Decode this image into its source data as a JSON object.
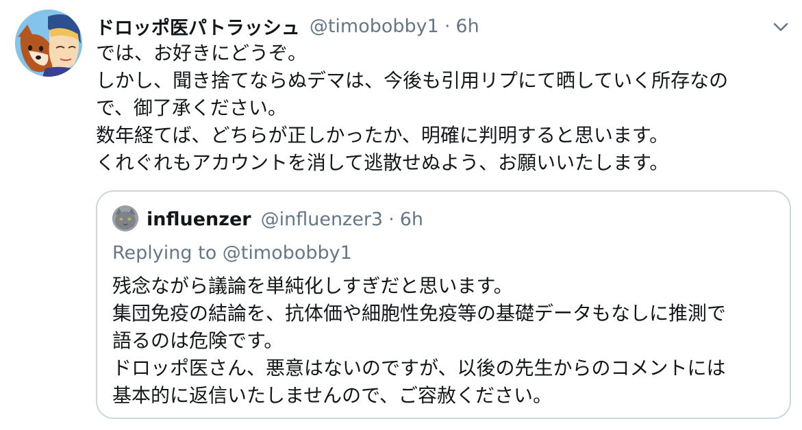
{
  "tweet": {
    "author": {
      "display_name": "ドロッポ医パトラッシュ",
      "handle": "@timobobby1",
      "separator": "·",
      "time": "6h"
    },
    "text_lines": [
      "では、お好きにどうぞ。",
      "しかし、聞き捨てならぬデマは、今後も引用リプにて晒していく所存なの",
      "で、御了承ください。",
      "数年経てば、どちらが正しかったか、明確に判明すると思います。",
      "くれぐれもアカウントを消して逃散せぬよう、お願いいたします。"
    ]
  },
  "quoted_tweet": {
    "author": {
      "display_name": "influenzer",
      "handle": "@influenzer3",
      "separator": "·",
      "time": "6h"
    },
    "replying_to": "Replying to @timobobby1",
    "text_lines": [
      "残念ながら議論を単純化しすぎだと思います。",
      "集団免疫の結論を、抗体価や細胞性免疫等の基礎データもなしに推測で",
      "語るのは危険です。",
      "ドロッポ医さん、悪意はないのですが、以後の先生からのコメントには",
      "基本的に返信いたしませんので、ご容赦ください。"
    ]
  },
  "icons": {
    "menu": "chevron-down-icon"
  },
  "colors": {
    "text_primary": "#14171a",
    "text_secondary": "#657786",
    "border": "#ccd6dd"
  }
}
